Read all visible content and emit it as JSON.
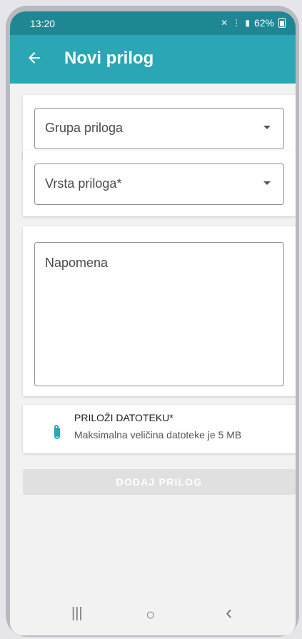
{
  "status_bar": {
    "time": "13:20",
    "battery": "62%",
    "icons": [
      "mute-icon",
      "wifi-icon",
      "signal-icon",
      "battery-icon"
    ]
  },
  "app_bar": {
    "title": "Novi prilog",
    "back_icon": "arrow-left-icon",
    "color": "#2aa6b4"
  },
  "form": {
    "group": {
      "placeholder": "Grupa priloga"
    },
    "type": {
      "placeholder": "Vrsta priloga*"
    },
    "note": {
      "placeholder": "Napomena"
    },
    "attachment": {
      "title": "PRILOŽI DATOTEKU*",
      "subtitle": "Maksimalna veličina datoteke je 5 MB",
      "icon": "paperclip-icon"
    },
    "add_button": {
      "label": "DODAJ PRILOG",
      "enabled": false
    }
  },
  "nav_bar": {
    "recents": "|||",
    "home": "○",
    "back": "‹"
  }
}
